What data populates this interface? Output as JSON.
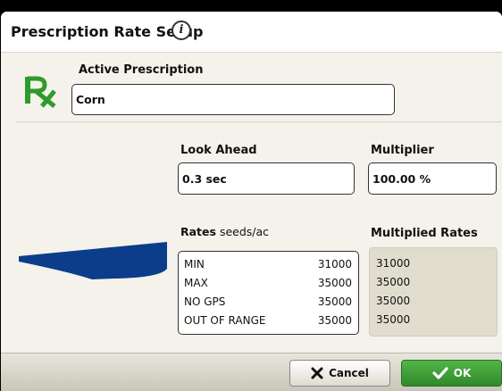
{
  "dialog": {
    "title": "Prescription Rate Setup",
    "info_icon_glyph": "i"
  },
  "active_prescription": {
    "label": "Active Prescription",
    "value": "Corn"
  },
  "look_ahead": {
    "label": "Look Ahead",
    "value": "0.3 sec"
  },
  "multiplier": {
    "label": "Multiplier",
    "value": "100.00 %"
  },
  "rates": {
    "label": "Rates",
    "units": "seeds/ac",
    "rows": [
      {
        "name": "MIN",
        "value": "31000"
      },
      {
        "name": "MAX",
        "value": "35000"
      },
      {
        "name": "NO GPS",
        "value": "35000"
      },
      {
        "name": "OUT OF RANGE",
        "value": "35000"
      }
    ]
  },
  "multiplied_rates": {
    "label": "Multiplied Rates",
    "values": [
      "31000",
      "35000",
      "35000",
      "35000"
    ]
  },
  "buttons": {
    "cancel": "Cancel",
    "ok": "OK"
  },
  "icons": {
    "rx": "prescription-rx-icon",
    "info": "info-icon",
    "cancel": "x-icon",
    "ok": "checkmark-icon",
    "implement": "planter-implement-icon"
  },
  "colors": {
    "rx_green": "#2e9b2b",
    "ok_green": "#3f9e38",
    "implement_blue": "#0c3d8a"
  }
}
